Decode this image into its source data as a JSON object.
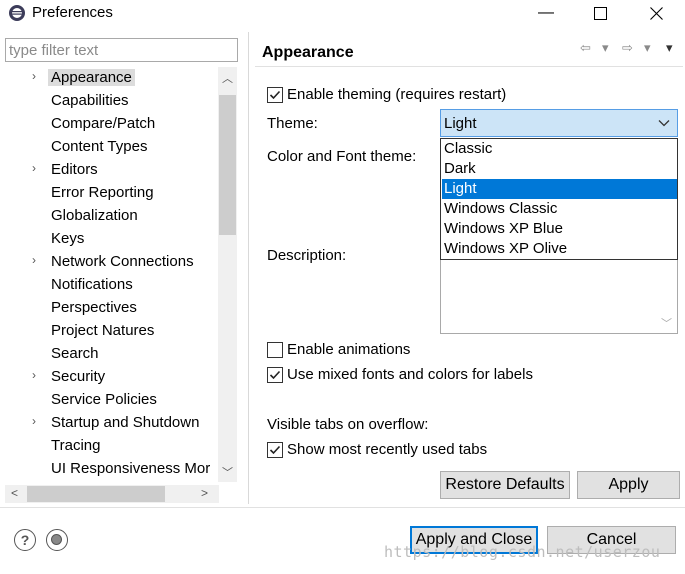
{
  "window": {
    "title": "Preferences",
    "minimize_glyph": "—",
    "maximize_glyph": "☐",
    "close_glyph": "✕"
  },
  "sidebar": {
    "filter_placeholder": "type filter text",
    "items": [
      {
        "label": "Appearance",
        "expandable": true,
        "selected": true
      },
      {
        "label": "Capabilities",
        "expandable": false
      },
      {
        "label": "Compare/Patch",
        "expandable": false
      },
      {
        "label": "Content Types",
        "expandable": false
      },
      {
        "label": "Editors",
        "expandable": true
      },
      {
        "label": "Error Reporting",
        "expandable": false
      },
      {
        "label": "Globalization",
        "expandable": false
      },
      {
        "label": "Keys",
        "expandable": false
      },
      {
        "label": "Network Connections",
        "expandable": true
      },
      {
        "label": "Notifications",
        "expandable": false
      },
      {
        "label": "Perspectives",
        "expandable": false
      },
      {
        "label": "Project Natures",
        "expandable": false
      },
      {
        "label": "Search",
        "expandable": false
      },
      {
        "label": "Security",
        "expandable": true
      },
      {
        "label": "Service Policies",
        "expandable": false
      },
      {
        "label": "Startup and Shutdown",
        "expandable": true
      },
      {
        "label": "Tracing",
        "expandable": false
      },
      {
        "label": "UI Responsiveness Mor",
        "expandable": false
      }
    ]
  },
  "page": {
    "title": "Appearance",
    "enable_theming": {
      "label": "Enable theming (requires restart)",
      "checked": true
    },
    "theme_label": "Theme:",
    "theme_value": "Light",
    "color_font_label": "Color and Font theme:",
    "description_label": "Description:",
    "theme_options": [
      "Classic",
      "Dark",
      "Light",
      "Windows Classic",
      "Windows XP Blue",
      "Windows XP Olive"
    ],
    "selected_option": "Light",
    "enable_animations": {
      "label": "Enable animations",
      "checked": false
    },
    "mixed_fonts": {
      "label": "Use mixed fonts and colors for labels",
      "checked": true
    },
    "visible_tabs_label": "Visible tabs on overflow:",
    "show_mru": {
      "label": "Show most recently used tabs",
      "checked": true
    },
    "restore_defaults": "Restore Defaults",
    "apply": "Apply"
  },
  "footer": {
    "apply_and_close": "Apply and Close",
    "cancel": "Cancel",
    "watermark": "https://blog.csdn.net/userzou"
  },
  "colors": {
    "selection": "#0078d7",
    "combo_bg": "#cce4f7"
  }
}
